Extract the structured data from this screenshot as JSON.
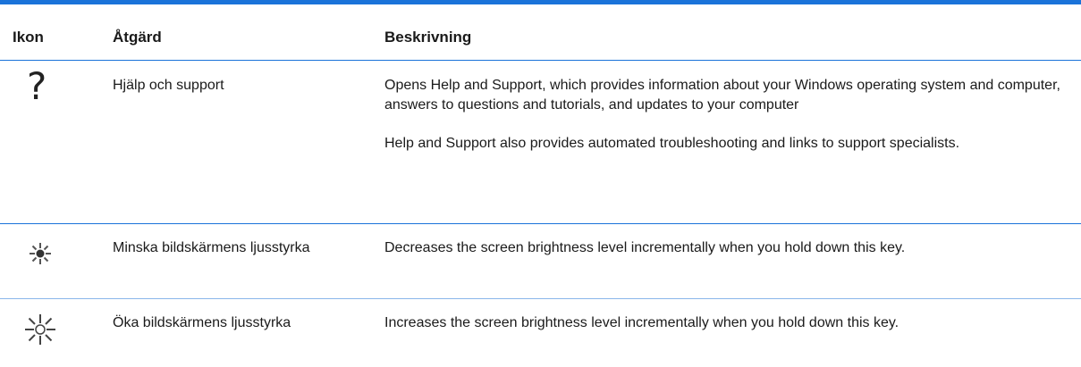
{
  "table": {
    "headers": {
      "icon": "Ikon",
      "action": "Åtgärd",
      "description": "Beskrivning"
    },
    "rows": [
      {
        "icon": "question-mark-icon",
        "action": "Hjälp och support",
        "description": [
          "Opens Help and Support, which provides information about your Windows operating system and computer, answers to questions and tutorials, and updates to your computer",
          "Help and Support also provides automated troubleshooting and links to support specialists."
        ]
      },
      {
        "icon": "brightness-down-icon",
        "action": "Minska bildskärmens ljusstyrka",
        "description": [
          "Decreases the screen brightness level incrementally when you hold down this key."
        ]
      },
      {
        "icon": "brightness-up-icon",
        "action": "Öka bildskärmens ljusstyrka",
        "description": [
          "Increases the screen brightness level incrementally when you hold down this key."
        ]
      }
    ]
  },
  "colors": {
    "rule": "#1a73d9",
    "text": "#1a1a1a"
  },
  "glyphs": {
    "question": "?"
  }
}
